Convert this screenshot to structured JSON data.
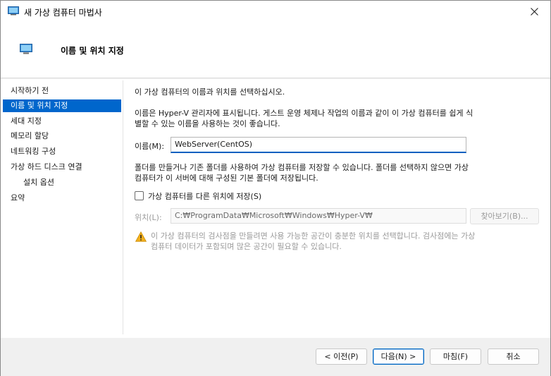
{
  "window": {
    "title": "새 가상 컴퓨터 마법사"
  },
  "header": {
    "title": "이름 및 위치 지정"
  },
  "nav": {
    "items": [
      {
        "label": "시작하기 전",
        "active": false,
        "sub": false
      },
      {
        "label": "이름 및 위치 지정",
        "active": true,
        "sub": false
      },
      {
        "label": "세대 지정",
        "active": false,
        "sub": false
      },
      {
        "label": "메모리 할당",
        "active": false,
        "sub": false
      },
      {
        "label": "네트워킹 구성",
        "active": false,
        "sub": false
      },
      {
        "label": "가상 하드 디스크 연결",
        "active": false,
        "sub": false
      },
      {
        "label": "설치 옵션",
        "active": false,
        "sub": true
      },
      {
        "label": "요약",
        "active": false,
        "sub": false
      }
    ]
  },
  "main": {
    "intro": "이 가상 컴퓨터의 이름과 위치를 선택하십시오.",
    "desc_line1": "이름은 Hyper-V 관리자에 표시됩니다. 게스트 운영 체제나 작업의 이름과 같이 이 가상 컴퓨터를 쉽게 식",
    "desc_line2": "별할 수 있는 이름을 사용하는 것이 좋습니다.",
    "name_label": "이름(M):",
    "name_value": "WebServer(CentOS)",
    "folder_line1": "폴더를 만들거나 기존 폴더를 사용하여 가상 컴퓨터를 저장할 수 있습니다. 폴더를 선택하지 않으면 가상",
    "folder_line2": "컴퓨터가 이 서버에 대해 구성된 기본 폴더에 저장됩니다.",
    "checkbox_label": "가상 컴퓨터를 다른 위치에 저장(S)",
    "location_label": "위치(L):",
    "location_value": "C:₩ProgramData₩Microsoft₩Windows₩Hyper-V₩",
    "browse_label": "찾아보기(B)...",
    "warning_line1": "이 가상 컴퓨터의 검사점을 만들려면 사용 가능한 공간이 충분한 위치를 선택합니다. 검사점에는 가상",
    "warning_line2": "컴퓨터 데이터가 포함되며 많은 공간이 필요할 수 있습니다."
  },
  "footer": {
    "prev_label": "< 이전(P)",
    "next_label": "다음(N) >",
    "finish_label": "마침(F)",
    "cancel_label": "취소"
  },
  "colors": {
    "accent": "#0066cc",
    "warning": "#e8a317"
  }
}
